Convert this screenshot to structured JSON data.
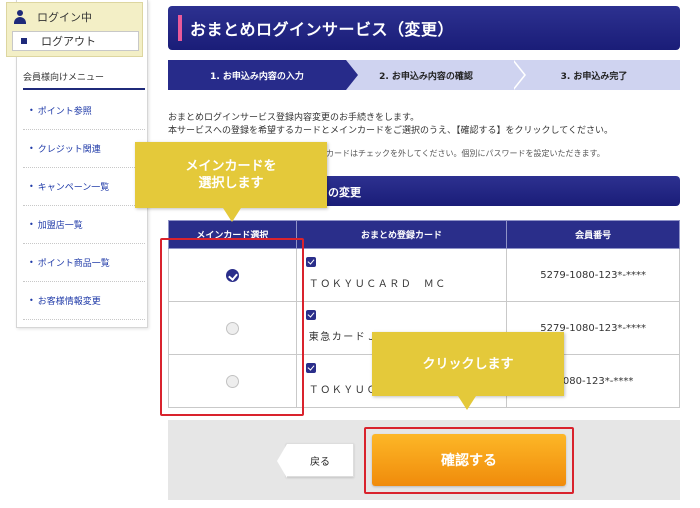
{
  "sidebar": {
    "login_status": "ログイン中",
    "logout_label": "ログアウト",
    "menu_title": "会員様向けメニュー",
    "items": [
      {
        "label": "ポイント参照"
      },
      {
        "label": "クレジット関連"
      },
      {
        "label": "キャンペーン一覧"
      },
      {
        "label": "加盟店一覧"
      },
      {
        "label": "ポイント商品一覧"
      },
      {
        "label": "お客様情報変更"
      }
    ]
  },
  "header": {
    "title": "おまとめログインサービス（変更）"
  },
  "steps": [
    {
      "label": "1. お申込み内容の入力"
    },
    {
      "label": "2. お申込み内容の確認"
    },
    {
      "label": "3. お申込み完了"
    }
  ],
  "description": {
    "line1": "おまとめログインサービス登録内容変更のお手続きをします。",
    "line2": "本サービスへの登録を希望するカードとメインカードをご選択のうえ、【確認する】をクリックしてください。",
    "note": "カードはチェックを外してください。個別にパスワードを設定いただきます。"
  },
  "section": {
    "title_visible": "の変更"
  },
  "table": {
    "headers": {
      "main_card": "メインカード選択",
      "card": "おまとめ登録カード",
      "member_no": "会員番号"
    },
    "rows": [
      {
        "card_name": "ＴＯＫＹＵＣＡＲＤ　ＭＣ",
        "member_no": "5279-1080-123*-****",
        "selected": true
      },
      {
        "card_name": "東急カードＪＭ",
        "member_no": "5279-1080-123*-****",
        "selected": false
      },
      {
        "card_name": "ＴＯＫＹＵＣＡ",
        "member_no": "-1080-123*-****",
        "selected": false
      }
    ]
  },
  "buttons": {
    "back": "戻る",
    "confirm": "確認する"
  },
  "callouts": {
    "main_card": "メインカードを\n選択します",
    "click": "クリックします"
  }
}
